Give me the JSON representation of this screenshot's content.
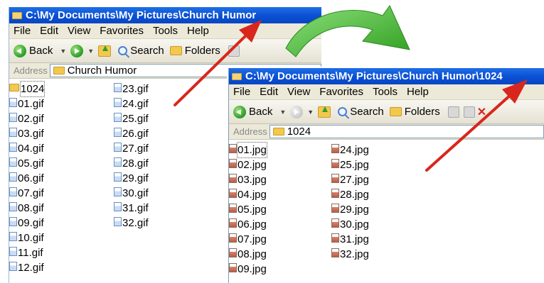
{
  "window1": {
    "title": "C:\\My Documents\\My Pictures\\Church Humor",
    "menu": [
      "File",
      "Edit",
      "View",
      "Favorites",
      "Tools",
      "Help"
    ],
    "toolbar": {
      "back": "Back",
      "search": "Search",
      "folders": "Folders"
    },
    "address_label": "Address",
    "address_value": "Church Humor",
    "files_col1": [
      "1024",
      "01.gif",
      "02.gif",
      "03.gif",
      "04.gif",
      "05.gif",
      "06.gif",
      "07.gif",
      "08.gif",
      "09.gif",
      "10.gif",
      "11.gif",
      "12.gif"
    ],
    "files_col2": [
      "23.gif",
      "24.gif",
      "25.gif",
      "26.gif",
      "27.gif",
      "28.gif",
      "29.gif",
      "30.gif",
      "31.gif",
      "32.gif"
    ]
  },
  "window2": {
    "title": "C:\\My Documents\\My Pictures\\Church Humor\\1024",
    "menu": [
      "File",
      "Edit",
      "View",
      "Favorites",
      "Tools",
      "Help"
    ],
    "toolbar": {
      "back": "Back",
      "search": "Search",
      "folders": "Folders"
    },
    "address_label": "Address",
    "address_value": "1024",
    "files_col1": [
      "01.jpg",
      "02.jpg",
      "03.jpg",
      "04.jpg",
      "05.jpg",
      "06.jpg",
      "07.jpg",
      "08.jpg",
      "09.jpg"
    ],
    "files_col2": [
      "24.jpg",
      "25.jpg",
      "27.jpg",
      "28.jpg",
      "29.jpg",
      "30.jpg",
      "31.jpg",
      "32.jpg"
    ]
  },
  "colors": {
    "titlebar": "#0a4fd3",
    "arrow_green": "#3dbb2f",
    "arrow_red": "#d9261c"
  },
  "icons": [
    "folder-icon",
    "back-icon",
    "forward-icon",
    "up-folder-icon",
    "search-icon",
    "folders-icon",
    "gif-file-icon",
    "jpg-file-icon",
    "green-curved-arrow",
    "red-pointer-arrow"
  ]
}
